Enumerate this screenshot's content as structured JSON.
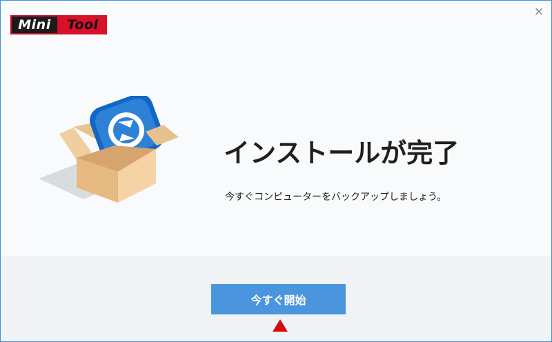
{
  "brand": {
    "logo_part1": "Mini",
    "logo_part2": "Tool",
    "logo_colors": {
      "dark": "#1b1b1b",
      "red": "#d7112a"
    }
  },
  "window": {
    "close_glyph": "×"
  },
  "content": {
    "title": "インストールが完了",
    "subtitle": "今すぐコンピューターをバックアップしましょう。"
  },
  "actions": {
    "start_label": "今すぐ開始",
    "start_color": "#4a95dd"
  },
  "annotation": {
    "marker": "red-up-arrow",
    "marker_color": "#d60d10"
  },
  "icons": {
    "illustration": "open-cardboard-box-with-backup-app-icon",
    "close": "close-icon"
  }
}
